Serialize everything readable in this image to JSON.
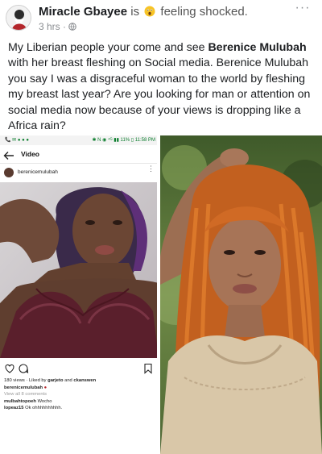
{
  "post": {
    "author": "Miracle Gbayee",
    "is_word": "is",
    "feeling": "feeling shocked.",
    "time": "3 hrs",
    "separator": "·",
    "more_icon": "more-horizontal-icon",
    "text_part1": "My Liberian people your come and see ",
    "text_bold": "Berenice Mulubah",
    "text_part2": " with her breast fleshing on Social media. Berenice Mulubah you say I was a disgraceful woman to the world by fleshing my breast last year? Are you looking for man or attention on social media now because of your views is dropping like a Africa rain?"
  },
  "instagram_screenshot": {
    "status_left": "📞 ✉ ● ● ●",
    "status_right": "✱ N ◉ ⁴ᴳ ▮▮ 11% ▯ 11:58 PM",
    "nav_title": "Video",
    "username": "berenicemulubah",
    "views_line": "180 views · Liked by",
    "liker1": "garjeto",
    "and_word": "and",
    "liker2": "ckanswen",
    "caption_user": "berenicemulubah",
    "view_comments": "View all 8 comments",
    "comment1_user": "mulbahtopoeh",
    "comment1_text": "Wocho",
    "comment2_user": "lopeaz15",
    "comment2_text": "Ok ohhhhhhhhhh."
  },
  "colors": {
    "text": "#1c1e21",
    "muted": "#8a8d91",
    "status_green": "#0a7d2c"
  }
}
